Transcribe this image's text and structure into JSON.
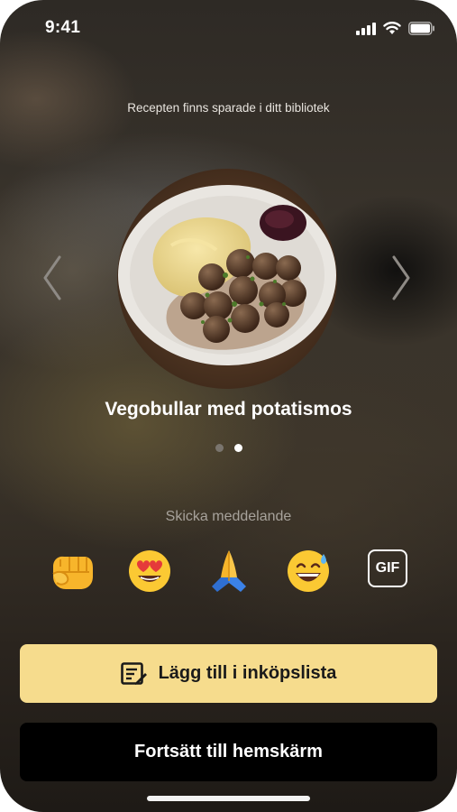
{
  "status_bar": {
    "time": "9:41",
    "icons": [
      "cellular-signal-icon",
      "wifi-icon",
      "battery-icon"
    ]
  },
  "subtitle": "Recepten finns sparade i ditt bibliotek",
  "carousel": {
    "recipe_title": "Vegobullar med potatismos",
    "image_description": "plate-of-meatballs-mash-lingonberries-icon",
    "page_count": 2,
    "active_page": 2,
    "prev_icon": "chevron-left-icon",
    "next_icon": "chevron-right-icon"
  },
  "messaging": {
    "label": "Skicka meddelande",
    "reactions": [
      {
        "name": "fist-bump-emoji",
        "glyph": "👊"
      },
      {
        "name": "heart-eyes-emoji",
        "glyph": "😍"
      },
      {
        "name": "folded-hands-emoji",
        "glyph": "🙏"
      },
      {
        "name": "grinning-sweat-emoji",
        "glyph": "😅"
      }
    ],
    "gif_label": "GIF"
  },
  "actions": {
    "shopping_list_label": "Lägg till i inköpslista",
    "shopping_list_icon": "list-edit-icon",
    "continue_label": "Fortsätt till hemskärm"
  },
  "colors": {
    "primary_button": "#f6dc8d",
    "secondary_button": "#000000",
    "text_primary": "#ffffff",
    "text_muted": "#a7a29b"
  }
}
